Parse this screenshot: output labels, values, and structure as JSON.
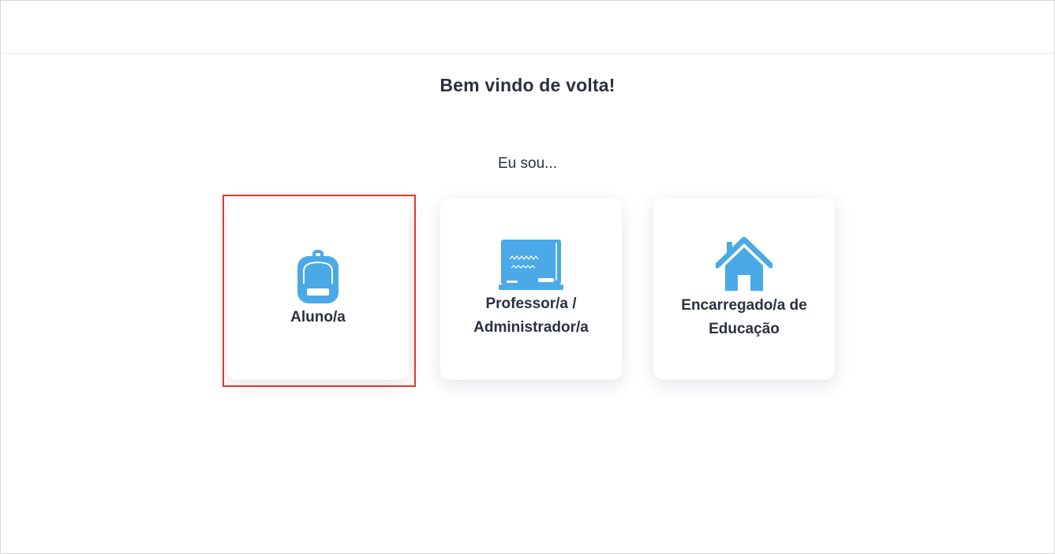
{
  "header": {
    "welcome": "Bem vindo de volta!",
    "prompt": "Eu sou..."
  },
  "roles": [
    {
      "label": "Aluno/a",
      "icon": "backpack-icon"
    },
    {
      "label_line1": "Professor/a /",
      "label_line2": "Administrador/a",
      "icon": "chalkboard-icon"
    },
    {
      "label_line1": "Encarregado/a de",
      "label_line2": "Educação",
      "icon": "house-icon"
    }
  ],
  "colors": {
    "icon": "#4aa9e6",
    "text": "#2b3040",
    "highlight": "#e0392b"
  }
}
